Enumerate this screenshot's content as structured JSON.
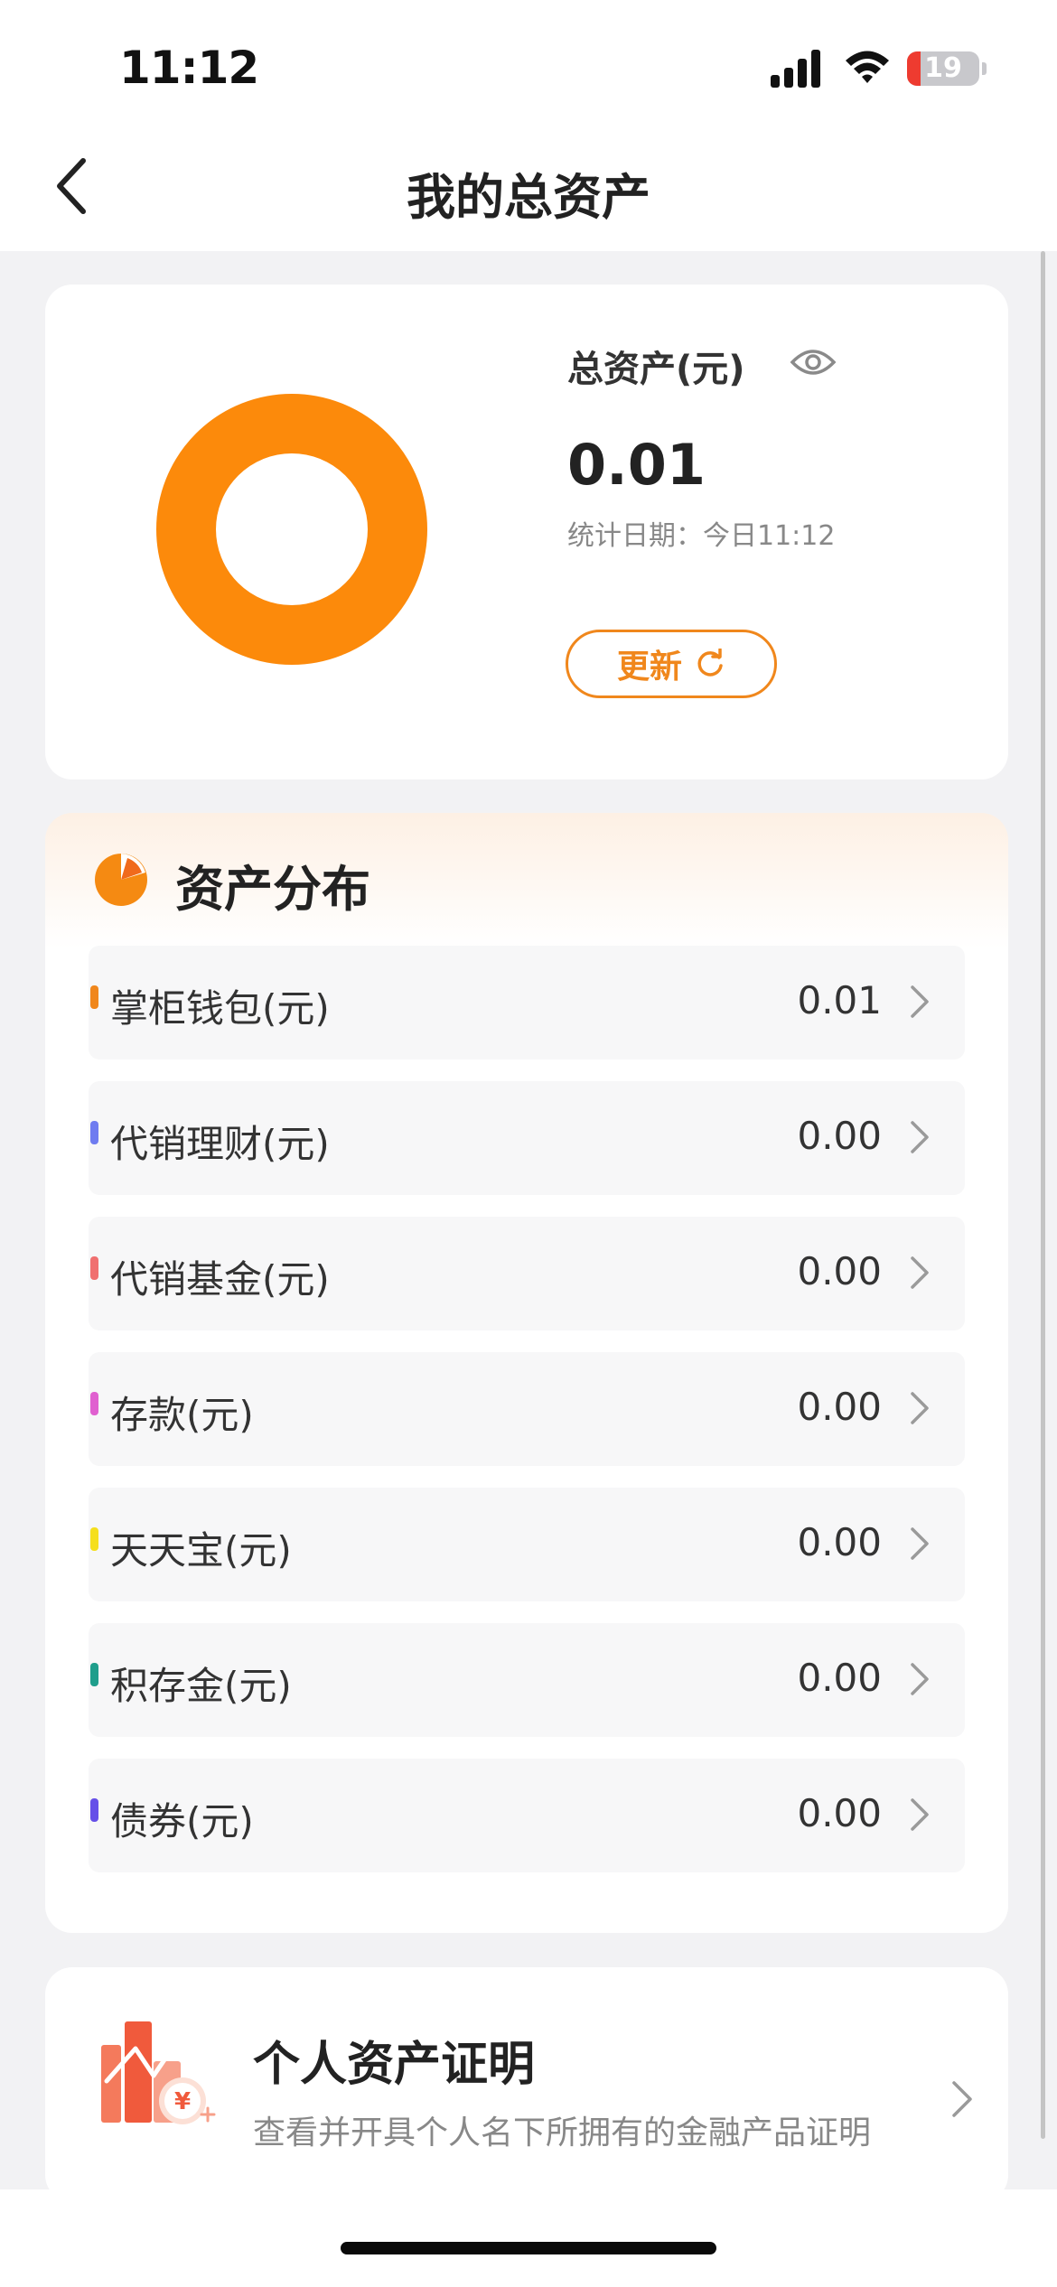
{
  "status_bar": {
    "time": "11:12",
    "battery": "19",
    "battery_level_percent": 19,
    "battery_color": "#ee3b30"
  },
  "nav": {
    "title": "我的总资产",
    "back_icon": "chevron-left-icon"
  },
  "summary": {
    "label": "总资产(元)",
    "eye_icon": "eye-icon",
    "value": "0.01",
    "date": "统计日期：今日11:12",
    "update_label": "更新",
    "refresh_icon": "refresh-icon",
    "donut_color": "#fc8a0b"
  },
  "distribution": {
    "title": "资产分布",
    "icon": "pie-chart-icon",
    "items": [
      {
        "label": "掌柜钱包(元)",
        "value": "0.01",
        "color": "#f0871c"
      },
      {
        "label": "代销理财(元)",
        "value": "0.00",
        "color": "#6f7cf0"
      },
      {
        "label": "代销基金(元)",
        "value": "0.00",
        "color": "#f07070"
      },
      {
        "label": "存款(元)",
        "value": "0.00",
        "color": "#e060d0"
      },
      {
        "label": "天天宝(元)",
        "value": "0.00",
        "color": "#f5df1c"
      },
      {
        "label": "积存金(元)",
        "value": "0.00",
        "color": "#1f9e8c"
      },
      {
        "label": "债券(元)",
        "value": "0.00",
        "color": "#6650e8"
      }
    ]
  },
  "certificate": {
    "title": "个人资产证明",
    "subtitle": "查看并开具个人名下所拥有的金融产品证明",
    "icon": "asset-certificate-icon",
    "currency_symbol": "¥"
  },
  "colors": {
    "accent": "#f0871c",
    "background": "#f2f2f4"
  }
}
